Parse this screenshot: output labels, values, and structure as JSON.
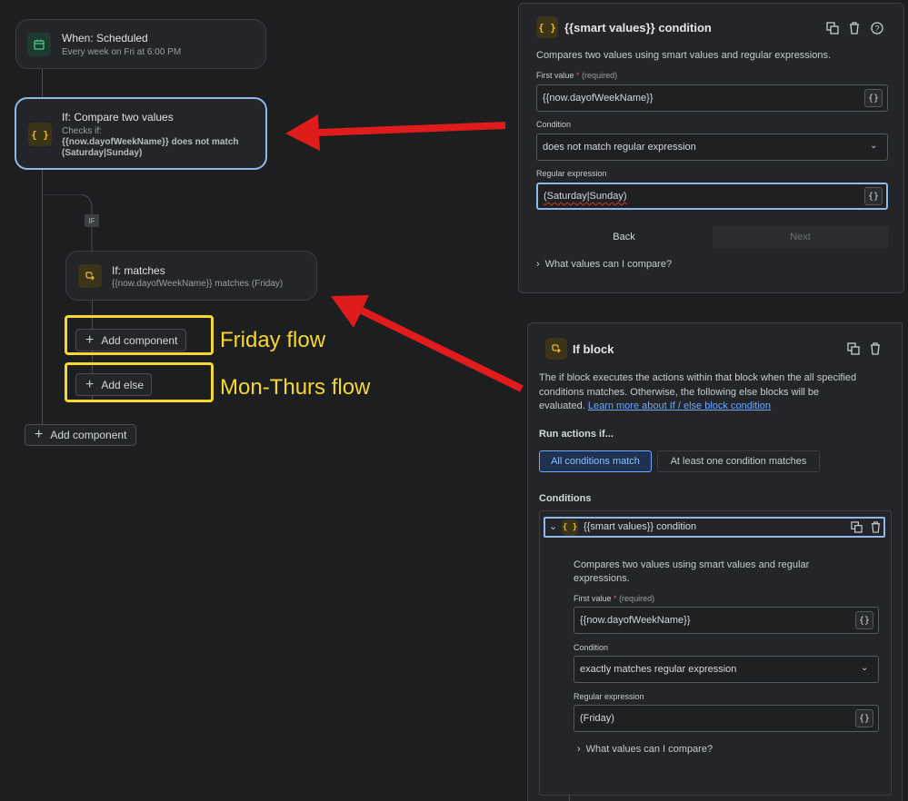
{
  "flow": {
    "trigger": {
      "title": "When: Scheduled",
      "subtitle": "Every week on Fri at 6:00 PM",
      "icon": "calendar-icon"
    },
    "compare": {
      "title": "If: Compare two values",
      "checks_label": "Checks if:",
      "line1": "{{now.dayofWeekName}} does not match",
      "line2": "(Saturday|Sunday)",
      "icon": "curly-braces-icon"
    },
    "if_badge": "IF",
    "matches": {
      "title": "If: matches",
      "subtitle": "{{now.dayofWeekName}} matches (Friday)",
      "icon": "branch-icon"
    },
    "add_component_inner": "Add component",
    "add_else": "Add else",
    "add_component_outer": "Add component"
  },
  "annotations": {
    "friday": "Friday flow",
    "monthurs": "Mon-Thurs flow",
    "highlight_color": "#f5d732",
    "arrow_color": "#e01b1b"
  },
  "top_panel": {
    "title": "{{smart values}} condition",
    "description": "Compares two values using smart values and regular expressions.",
    "first_value_label": "First value",
    "required_star": "*",
    "required_text": "(required)",
    "first_value": "{{now.dayofWeekName}}",
    "condition_label": "Condition",
    "condition_value": "does not match regular expression",
    "regex_label": "Regular expression",
    "regex_value": "(Saturday|Sunday)",
    "curly": "{}",
    "back": "Back",
    "next": "Next",
    "help": "What values can I compare?"
  },
  "if_panel": {
    "title": "If block",
    "description_line1": "The if block executes the actions within that block when the all specified",
    "description_line2": "conditions matches. Otherwise, the following else blocks will be",
    "description_line3": "evaluated.",
    "learn_more": "Learn more about If / else block condition",
    "run_actions": "Run actions if...",
    "all_match": "All conditions match",
    "at_least_one": "At least one condition matches",
    "conditions": "Conditions",
    "condition_title": "{{smart values}} condition",
    "cond_desc_line1": "Compares two values using smart values and regular",
    "cond_desc_line2": "expressions.",
    "first_value_label": "First value",
    "required_star": "*",
    "required_text": "(required)",
    "first_value": "{{now.dayofWeekName}}",
    "condition_label": "Condition",
    "condition_value": "exactly matches regular expression",
    "regex_label": "Regular expression",
    "regex_value": "(Friday)",
    "curly": "{}",
    "help": "What values can I compare?"
  }
}
